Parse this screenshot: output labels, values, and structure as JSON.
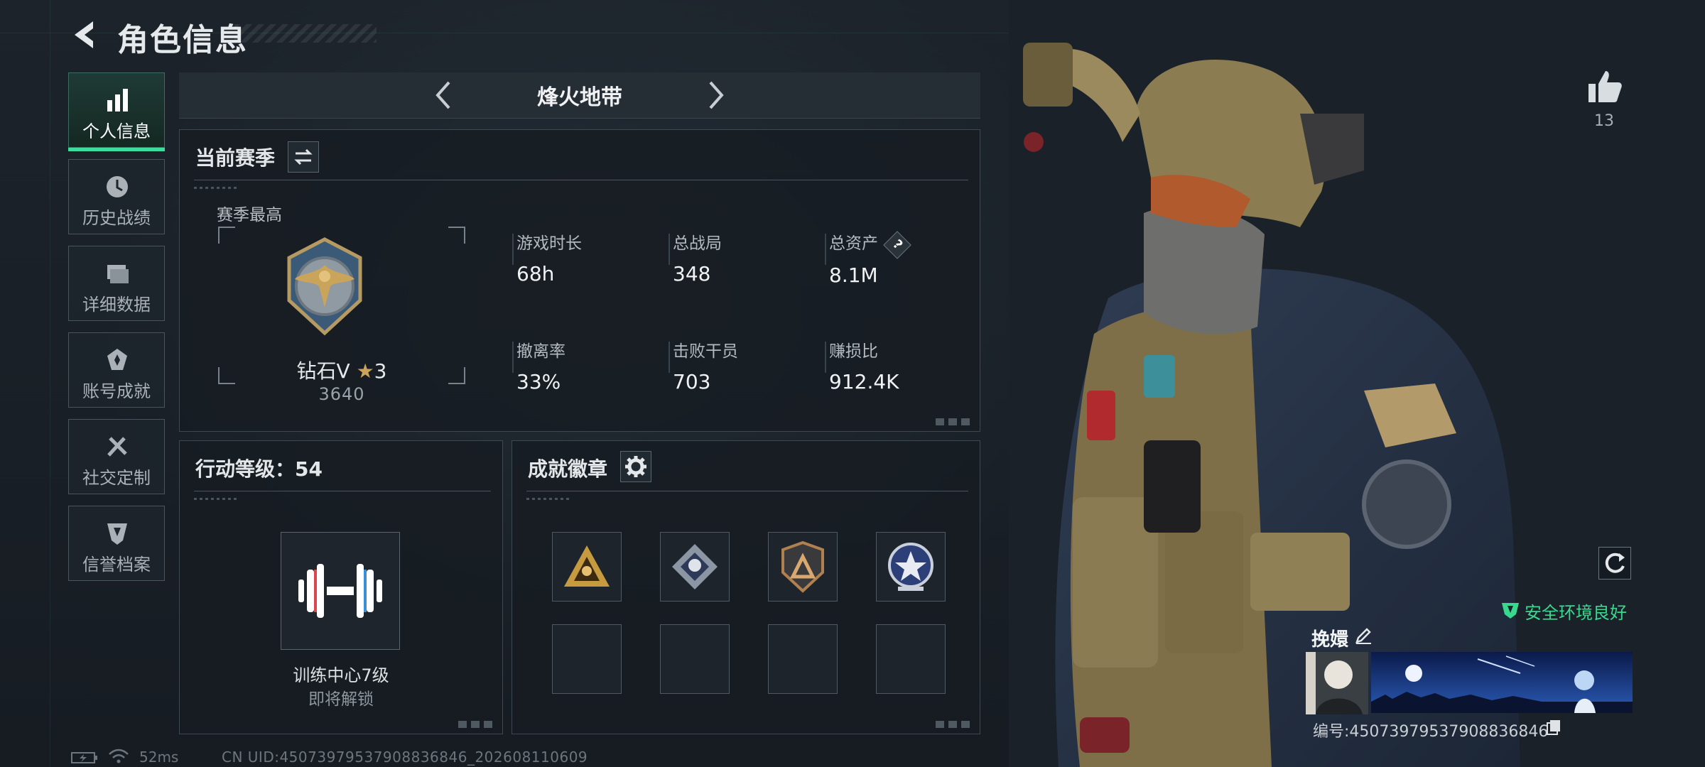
{
  "header": {
    "title": "角色信息"
  },
  "nav": {
    "items": [
      {
        "label": "个人信息",
        "active": true,
        "icon": "bar-chart-icon"
      },
      {
        "label": "历史战绩",
        "active": false,
        "icon": "history-clock-icon"
      },
      {
        "label": "详细数据",
        "active": false,
        "icon": "folder-icon"
      },
      {
        "label": "账号成就",
        "active": false,
        "icon": "achievement-icon"
      },
      {
        "label": "社交定制",
        "active": false,
        "icon": "tools-icon"
      },
      {
        "label": "信誉档案",
        "active": false,
        "icon": "credit-shield-icon"
      }
    ]
  },
  "mode": {
    "title": "烽火地带"
  },
  "season": {
    "title": "当前赛季",
    "best_label": "赛季最高",
    "rank_name": "钻石V",
    "rank_stars": "3",
    "rank_score": "3640",
    "stats": [
      {
        "label": "游戏时长",
        "value": "68h"
      },
      {
        "label": "总战局",
        "value": "348"
      },
      {
        "label": "总资产",
        "value": "8.1M",
        "help": "?"
      },
      {
        "label": "撤离率",
        "value": "33%"
      },
      {
        "label": "击败干员",
        "value": "703"
      },
      {
        "label": "赚损比",
        "value": "912.4K"
      }
    ]
  },
  "action_level": {
    "title": "行动等级：54",
    "training_name": "训练中心7级",
    "training_status": "即将解锁"
  },
  "badges": {
    "title": "成就徽章",
    "items": [
      {
        "icon": "gold-triangle-badge-icon",
        "filled": true
      },
      {
        "icon": "silver-diamond-badge-icon",
        "filled": true
      },
      {
        "icon": "bronze-shield-badge-icon",
        "filled": true
      },
      {
        "icon": "blue-star-badge-icon",
        "filled": true
      },
      {
        "filled": false
      },
      {
        "filled": false
      },
      {
        "filled": false
      },
      {
        "filled": false
      }
    ]
  },
  "profile": {
    "likes": "13",
    "safe_status": "安全环境良好",
    "player_name": "挽嬛",
    "player_id": "编号:45073979537908836846"
  },
  "status": {
    "ping": "52ms",
    "uid": "CN UID:45073979537908836846_202608110609"
  },
  "colors": {
    "accent_green": "#3ddc9f",
    "safe_green": "#38d98f",
    "background": "#1a2129"
  }
}
